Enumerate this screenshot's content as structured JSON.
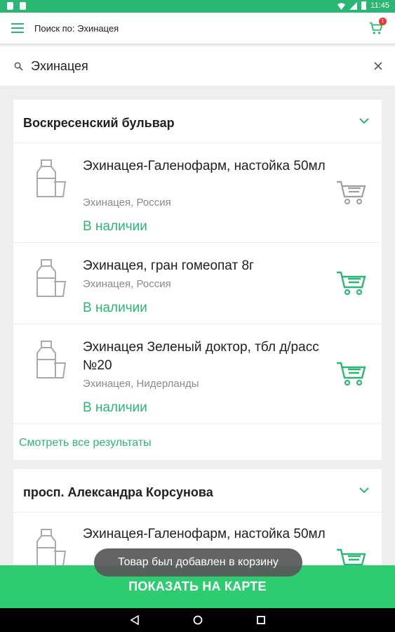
{
  "status_bar": {
    "time": "11:45"
  },
  "app_bar": {
    "title": "Поиск по: Эхинацея",
    "cart_count": "1"
  },
  "search": {
    "value": "Эхинацея"
  },
  "pharmacies": [
    {
      "name": "Воскресенский бульвар",
      "items": [
        {
          "name": "Эхинацея-Галенофарм, настойка 50мл",
          "subtitle": "Эхинацея, Россия",
          "status": "В наличии"
        },
        {
          "name": "Эхинацея, гран гомеопат 8г",
          "subtitle": "Эхинацея, Россия",
          "status": "В наличии"
        },
        {
          "name": "Эхинацея Зеленый доктор, тбл д/расс №20",
          "subtitle": "Эхинацея, Нидерланды",
          "status": "В наличии"
        }
      ],
      "see_all": "Смотреть все результаты"
    },
    {
      "name": "просп. Александра Корсунова",
      "items": [
        {
          "name": "Эхинацея-Галенофарм, настойка 50мл"
        }
      ]
    }
  ],
  "toast": "Товар был добавлен в корзину",
  "map_button": "ПОКАЗАТЬ НА КАРТЕ",
  "colors": {
    "accent": "#2bb673",
    "button": "#2ecc71",
    "badge": "#e53935"
  }
}
